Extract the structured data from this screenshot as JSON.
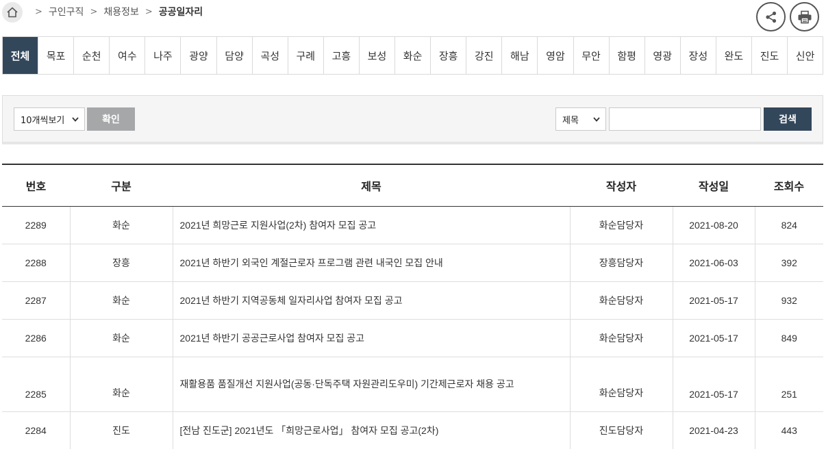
{
  "breadcrumb": {
    "items": [
      "구인구직",
      "채용정보"
    ],
    "current": "공공일자리"
  },
  "tabs": [
    "전체",
    "목포",
    "순천",
    "여수",
    "나주",
    "광양",
    "담양",
    "곡성",
    "구례",
    "고흥",
    "보성",
    "화순",
    "장흥",
    "강진",
    "해남",
    "영암",
    "무안",
    "함평",
    "영광",
    "장성",
    "완도",
    "진도",
    "신안"
  ],
  "active_tab": "전체",
  "search": {
    "per_page": "10개씩보기",
    "confirm_label": "확인",
    "field": "제목",
    "keyword": "",
    "search_label": "검색"
  },
  "table": {
    "columns": [
      "번호",
      "구분",
      "제목",
      "작성자",
      "작성일",
      "조회수"
    ],
    "rows": [
      {
        "no": "2289",
        "cat": "화순",
        "title": "2021년 희망근로 지원사업(2차) 참여자 모집 공고",
        "author": "화순담당자",
        "date": "2021-08-20",
        "views": "824"
      },
      {
        "no": "2288",
        "cat": "장흥",
        "title": "2021년 하반기 외국인 계절근로자 프로그램 관련 내국인 모집 안내",
        "author": "장흥담당자",
        "date": "2021-06-03",
        "views": "392"
      },
      {
        "no": "2287",
        "cat": "화순",
        "title": "2021년 하반기 지역공동체 일자리사업 참여자 모집 공고",
        "author": "화순담당자",
        "date": "2021-05-17",
        "views": "932"
      },
      {
        "no": "2286",
        "cat": "화순",
        "title": "2021년 하반기 공공근로사업 참여자 모집 공고",
        "author": "화순담당자",
        "date": "2021-05-17",
        "views": "849"
      },
      {
        "no": "2285",
        "cat": "화순",
        "title": "재활용품 품질개선 지원사업(공동·단독주택 자원관리도우미) 기간제근로자 채용 공고",
        "author": "화순담당자",
        "date": "2021-05-17",
        "views": "251"
      },
      {
        "no": "2284",
        "cat": "진도",
        "title": "[전남 진도군] 2021년도 「희망근로사업」 참여자 모집 공고(2차)",
        "author": "진도담당자",
        "date": "2021-04-23",
        "views": "443"
      }
    ]
  }
}
